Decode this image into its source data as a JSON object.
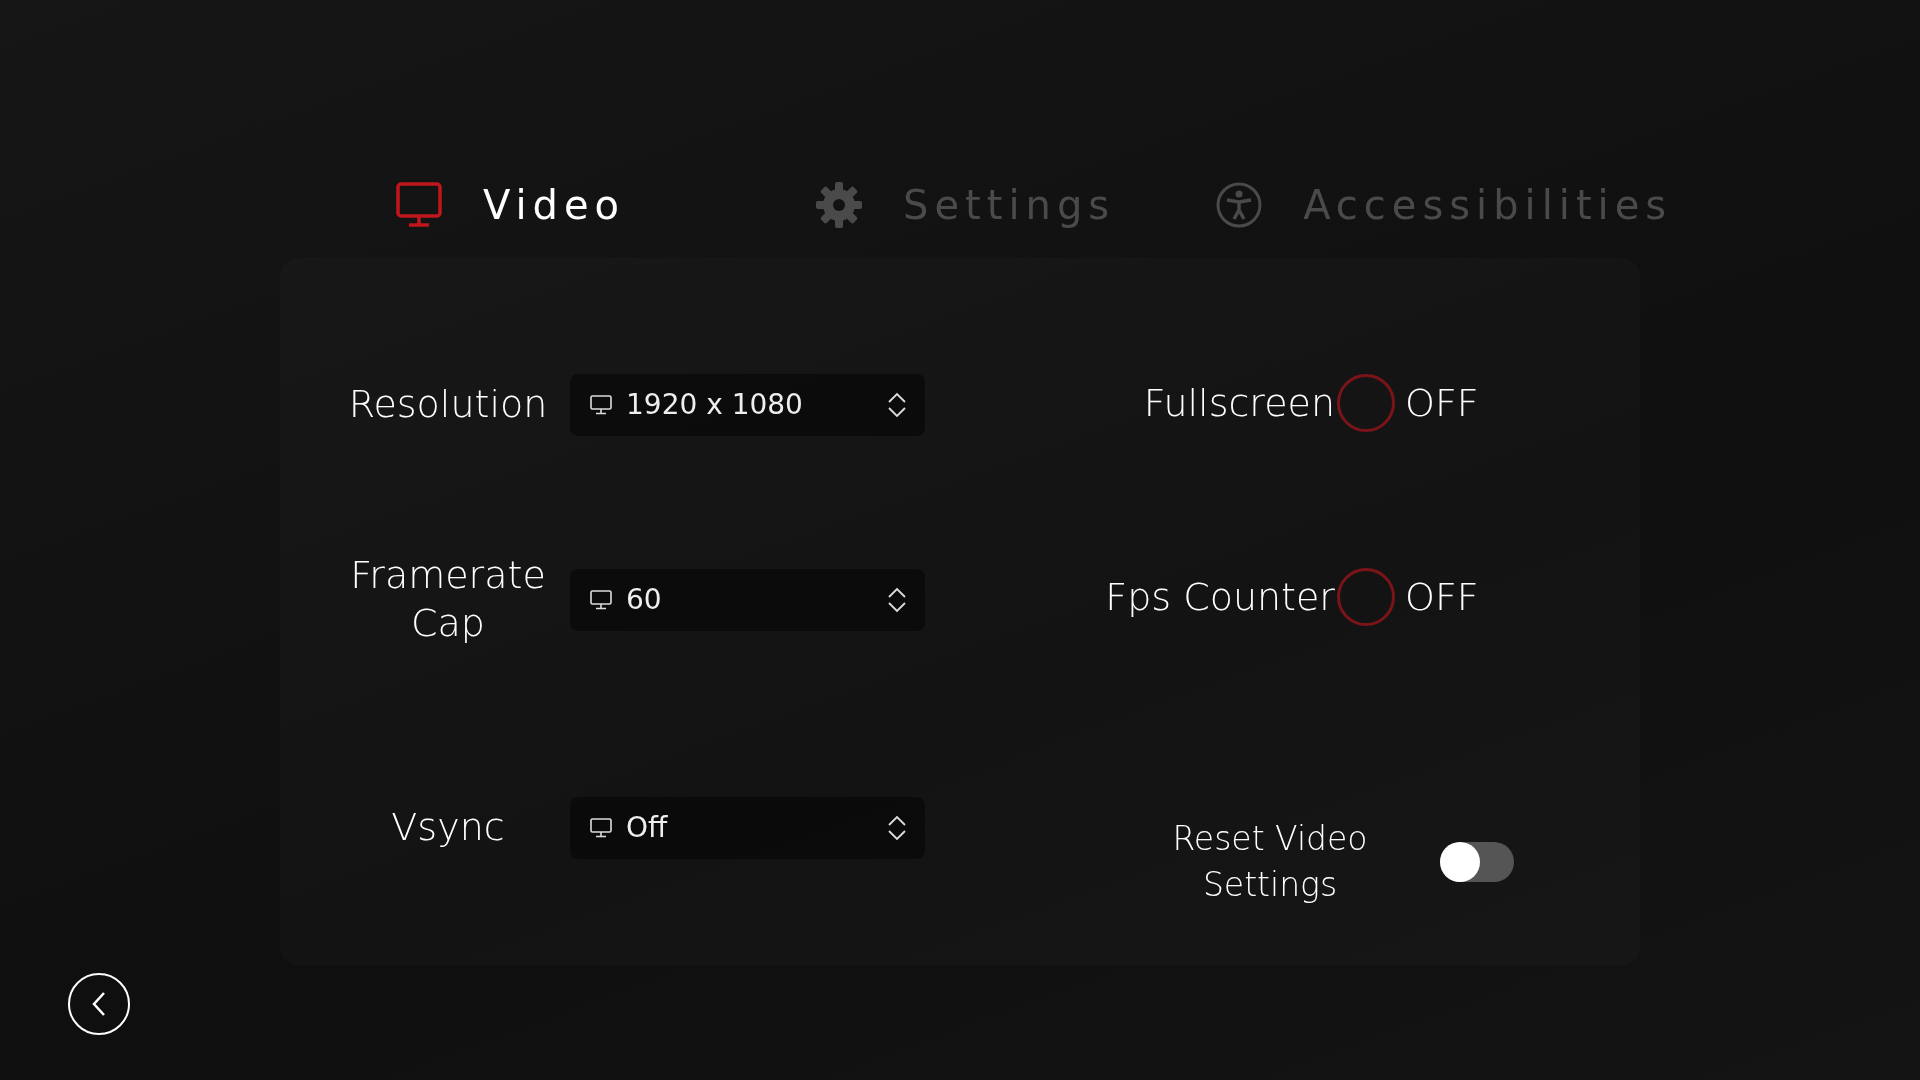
{
  "tabs": [
    {
      "label": "Video",
      "selected": true
    },
    {
      "label": "Settings",
      "selected": false
    },
    {
      "label": "Accessibilities",
      "selected": false
    }
  ],
  "left_settings": [
    {
      "label": "Resolution",
      "value": "1920 x 1080"
    },
    {
      "label": "Framerate Cap",
      "value": "60"
    },
    {
      "label": "Vsync",
      "value": "Off"
    }
  ],
  "right_settings": [
    {
      "kind": "circle",
      "label": "Fullscreen",
      "on": false,
      "state_text": "OFF"
    },
    {
      "kind": "circle",
      "label": "Fps Counter",
      "on": false,
      "state_text": "OFF"
    },
    {
      "kind": "switch",
      "label": "Reset Video Settings",
      "on": false
    }
  ]
}
